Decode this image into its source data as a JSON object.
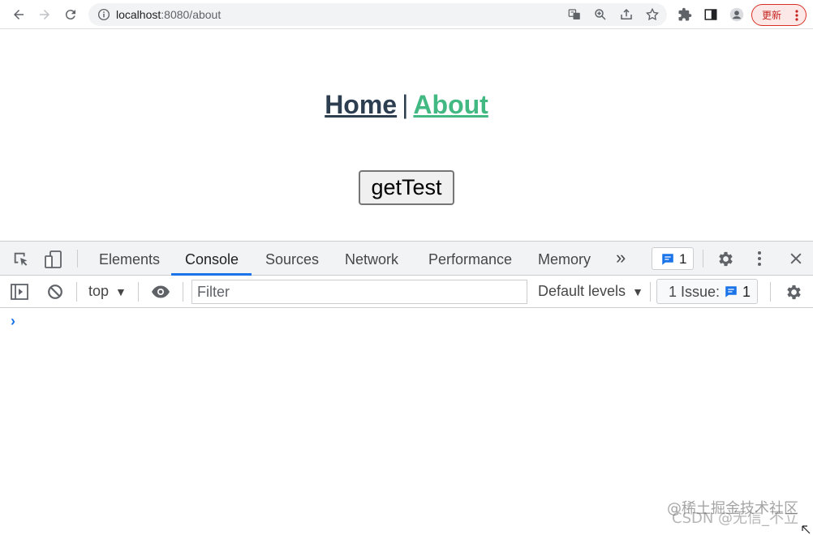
{
  "browser": {
    "url_host": "localhost",
    "url_path": ":8080/about",
    "update_label": "更新"
  },
  "page": {
    "nav": {
      "home": "Home",
      "separator": "|",
      "about": "About"
    },
    "button_label": "getTest"
  },
  "devtools": {
    "tabs": [
      "Elements",
      "Console",
      "Sources",
      "Network",
      "Performance",
      "Memory"
    ],
    "active_tab": "Console",
    "overflow_label": "»",
    "issues_count": "1",
    "console": {
      "context": "top",
      "filter_placeholder": "Filter",
      "levels": "Default levels",
      "issue_label": "1 Issue:",
      "issue_count": "1",
      "prompt": "›"
    }
  },
  "watermark": {
    "line1": "@稀土掘金技术社区",
    "line2": "CSDN @无信_不立"
  },
  "colors": {
    "nav_active": "#42b983",
    "nav_default": "#2c3e50",
    "accent": "#1a73e8"
  }
}
